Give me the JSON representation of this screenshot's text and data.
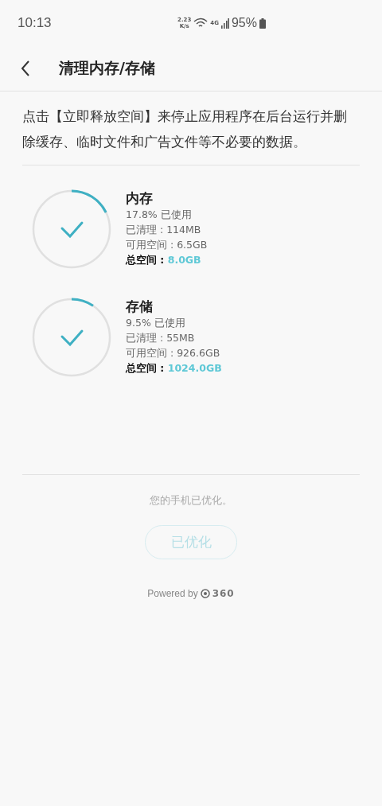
{
  "status_bar": {
    "time": "10:13",
    "speed": "2.23",
    "speed_unit": "K/s",
    "network": "4G",
    "battery": "95%"
  },
  "header": {
    "title": "清理内存/存储"
  },
  "description": "点击【立即释放空间】来停止应用程序在后台运行并删除缓存、临时文件和广告文件等不必要的数据。",
  "storage_items": [
    {
      "title": "内存",
      "used": "17.8% 已使用",
      "cleaned": "已清理 : 114MB",
      "available": "可用空间 : 6.5GB",
      "total_label": "总空间 :",
      "total_value": "8.0GB"
    },
    {
      "title": "存储",
      "used": "9.5% 已使用",
      "cleaned": "已清理 : 55MB",
      "available": "可用空间 : 926.6GB",
      "total_label": "总空间 :",
      "total_value": "1024.0GB"
    }
  ],
  "message": "您的手机已优化。",
  "action_button": {
    "label": "已优化",
    "disabled": true
  },
  "powered_by": {
    "text": "Powered by",
    "brand": "360"
  }
}
